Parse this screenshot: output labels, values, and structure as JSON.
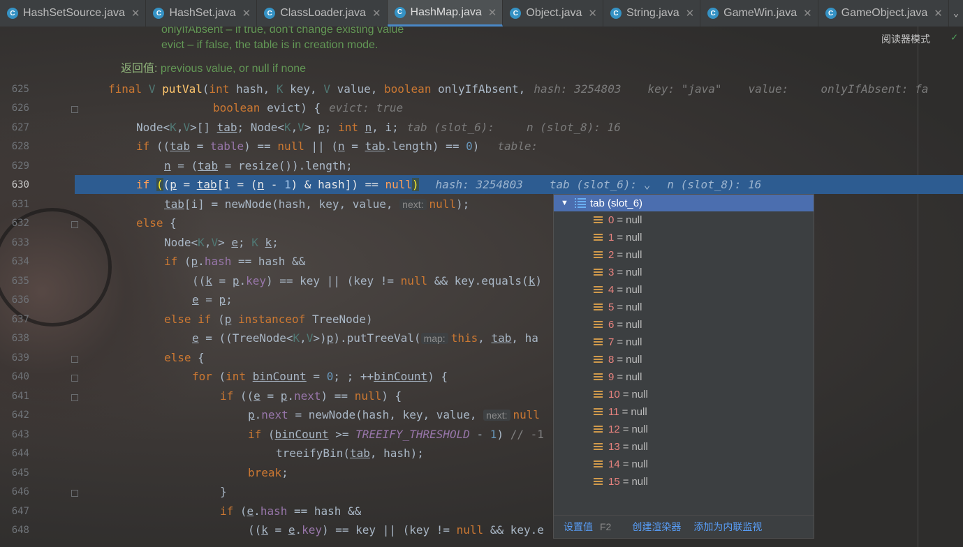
{
  "tabs": [
    {
      "name": "HashSetSource.java",
      "active": false
    },
    {
      "name": "HashSet.java",
      "active": false
    },
    {
      "name": "ClassLoader.java",
      "active": false
    },
    {
      "name": "HashMap.java",
      "active": true
    },
    {
      "name": "Object.java",
      "active": false
    },
    {
      "name": "String.java",
      "active": false
    },
    {
      "name": "GameWin.java",
      "active": false
    },
    {
      "name": "GameObject.java",
      "active": false
    }
  ],
  "javadoc": {
    "line1": "onlyIfAbsent – if true, don't change existing value",
    "line2": "evict – if false, the table is in creation mode.",
    "return_label": "返回值:",
    "return_text": "previous value, or null if none"
  },
  "reader_mode": "阅读器模式",
  "line_numbers": [
    "625",
    "626",
    "627",
    "628",
    "629",
    "630",
    "631",
    "632",
    "633",
    "634",
    "635",
    "636",
    "637",
    "638",
    "639",
    "640",
    "641",
    "642",
    "643",
    "644",
    "645",
    "646",
    "647",
    "648"
  ],
  "current_line": "630",
  "hints": {
    "l625_hash": "hash: 3254803",
    "l625_key": "key: \"java\"",
    "l625_value": "value:",
    "l625_onlyIfAbsent": "onlyIfAbsent: fa",
    "l626_evict": "evict: true",
    "l627_tab": "tab (slot_6):",
    "l627_n": "n (slot_8): 16",
    "l628_table": "table:",
    "l630_hash": "hash: 3254803",
    "l630_tab": "tab (slot_6): ⌄",
    "l630_n": "n (slot_8): 16",
    "param_next": "next:",
    "param_map": "map:"
  },
  "popup": {
    "header": "tab (slot_6)",
    "items": [
      {
        "index": "0",
        "value": "null"
      },
      {
        "index": "1",
        "value": "null"
      },
      {
        "index": "2",
        "value": "null"
      },
      {
        "index": "3",
        "value": "null"
      },
      {
        "index": "4",
        "value": "null"
      },
      {
        "index": "5",
        "value": "null"
      },
      {
        "index": "6",
        "value": "null"
      },
      {
        "index": "7",
        "value": "null"
      },
      {
        "index": "8",
        "value": "null"
      },
      {
        "index": "9",
        "value": "null"
      },
      {
        "index": "10",
        "value": "null"
      },
      {
        "index": "11",
        "value": "null"
      },
      {
        "index": "12",
        "value": "null"
      },
      {
        "index": "13",
        "value": "null"
      },
      {
        "index": "14",
        "value": "null"
      },
      {
        "index": "15",
        "value": "null"
      }
    ],
    "footer": {
      "set_value": "设置值",
      "set_value_key": "F2",
      "create_renderer": "创建渲染器",
      "add_watch": "添加为内联监视"
    }
  },
  "colors": {
    "accent": "#4b6eaf",
    "exec_line": "#2d5c91",
    "keyword": "#cc7832"
  }
}
